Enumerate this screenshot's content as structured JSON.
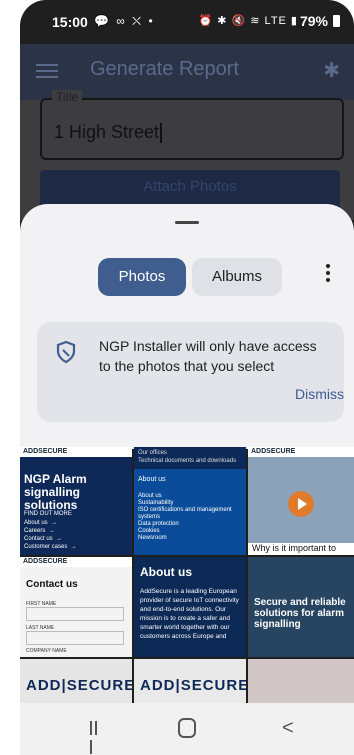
{
  "status": {
    "time": "15:00",
    "left_icons": "💬 ∞ ⛌ •",
    "right_icons": "⏰ ✱ 🔇 ≋ LTE ▮",
    "battery": "79%"
  },
  "appbar": {
    "title": "Generate Report"
  },
  "form": {
    "title_label": "Title",
    "title_value": "1 High Street",
    "attach_label": "Attach Photos"
  },
  "picker": {
    "tabs": [
      {
        "label": "Photos"
      },
      {
        "label": "Albums"
      }
    ],
    "notice": {
      "message": "NGP Installer will only have access to the photos that you select",
      "dismiss": "Dismiss"
    }
  },
  "tiles": {
    "t1": {
      "header": "ADDSECURE",
      "title": "NGP Alarm signalling solutions",
      "find": "FIND OUT MORE",
      "links": "About us  →\nCareers  →\nContact us  →\nCustomer cases  →"
    },
    "t2": {
      "top": "Our offices\nTechnical documents and downloads",
      "about": "About us",
      "list": "About us\nSustainability\nISO certifications and management systems\nData protection\nCookies\nNewsroom"
    },
    "t3": {
      "header": "ADDSECURE",
      "caption": "Why is it important to"
    },
    "t4": {
      "header": "ADDSECURE",
      "title": "Contact us",
      "f1": "FIRST NAME",
      "f2": "LAST NAME",
      "f3": "COMPANY NAME"
    },
    "t5": {
      "title": "About us",
      "body": "AddSecure is a leading European provider of secure IoT connectivity and end-to-end solutions. Our mission is to create a safer and smarter world together with our customers across Europe and"
    },
    "t6": {
      "title": "Secure and reliable solutions for alarm signalling"
    },
    "t7": {
      "logo": "ADD|SECURE"
    },
    "t8": {
      "logo": "ADD|SECURE"
    }
  }
}
